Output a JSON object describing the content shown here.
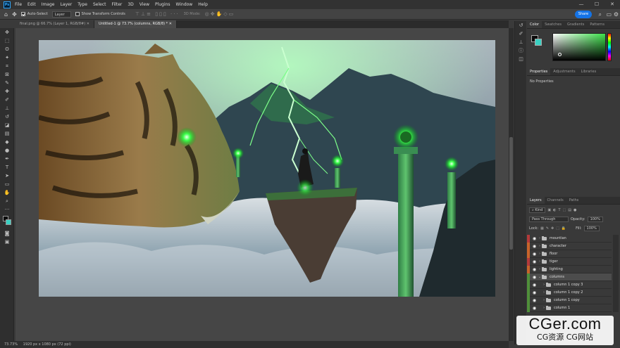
{
  "menubar": {
    "app_icon": "Ps",
    "items": [
      "File",
      "Edit",
      "Image",
      "Layer",
      "Type",
      "Select",
      "Filter",
      "3D",
      "View",
      "Plugins",
      "Window",
      "Help"
    ],
    "window_controls": [
      "—",
      "☐",
      "✕"
    ]
  },
  "options": {
    "auto_select_label": "Auto-Select",
    "auto_select_checked": true,
    "target_value": "Layer",
    "transform_controls_label": "Show Transform Controls",
    "mode_3d_label": "3D Mode:",
    "share_label": "Share"
  },
  "tabs": [
    {
      "label": "final.png @ 66.7% (Layer 1, RGB/8#)",
      "active": false
    },
    {
      "label": "Untitled-1 @ 73.7% (columns, RGB/8) *",
      "active": true
    }
  ],
  "tools": [
    "move-icon",
    "marquee-icon",
    "lasso-icon",
    "magic-wand-icon",
    "crop-icon",
    "frame-icon",
    "eyedropper-icon",
    "healing-icon",
    "brush-icon",
    "stamp-icon",
    "history-brush-icon",
    "eraser-icon",
    "gradient-icon",
    "blur-icon",
    "dodge-icon",
    "pen-icon",
    "type-icon",
    "path-select-icon",
    "shape-icon",
    "hand-icon",
    "zoom-icon",
    "more-icon"
  ],
  "status": {
    "zoom": "73.73%",
    "doc_info": "1920 px x 1080 px (72 ppi)"
  },
  "color_panel": {
    "tabs": [
      "Color",
      "Swatches",
      "Gradients",
      "Patterns"
    ],
    "active_tab": "Color",
    "foreground": "#0a0a0a",
    "background": "#3ad0c2",
    "hue": "#3ce14a"
  },
  "properties_panel": {
    "tabs": [
      "Properties",
      "Adjustments",
      "Libraries"
    ],
    "active_tab": "Properties",
    "message": "No Properties"
  },
  "layers_panel": {
    "tabs": [
      "Layers",
      "Channels",
      "Paths"
    ],
    "active_tab": "Layers",
    "filter_label": "Kind",
    "blend_mode": "Pass Through",
    "opacity_label": "Opacity:",
    "opacity_value": "100%",
    "lock_label": "Lock:",
    "fill_label": "Fill:",
    "fill_value": "100%",
    "layers": [
      {
        "name": "mountian",
        "color": "#b53a3a",
        "indent": 0,
        "selected": false
      },
      {
        "name": "character",
        "color": "#c8632a",
        "indent": 0,
        "selected": false
      },
      {
        "name": "floor",
        "color": "#c8632a",
        "indent": 0,
        "selected": false
      },
      {
        "name": "tiger",
        "color": "#b53a3a",
        "indent": 0,
        "selected": false
      },
      {
        "name": "lighting",
        "color": "#c8632a",
        "indent": 0,
        "selected": false
      },
      {
        "name": "columns",
        "color": "#4f8f3a",
        "indent": 0,
        "selected": true
      },
      {
        "name": "column 1 copy 3",
        "color": "#4f8f3a",
        "indent": 1,
        "selected": false
      },
      {
        "name": "column 1 copy 2",
        "color": "#4f8f3a",
        "indent": 1,
        "selected": false
      },
      {
        "name": "column 1 copy",
        "color": "#4f8f3a",
        "indent": 1,
        "selected": false
      },
      {
        "name": "column 1",
        "color": "#4f8f3a",
        "indent": 1,
        "selected": false
      }
    ]
  },
  "watermark": {
    "main": "CGer.com",
    "sub": "CG资源 CG网站"
  }
}
